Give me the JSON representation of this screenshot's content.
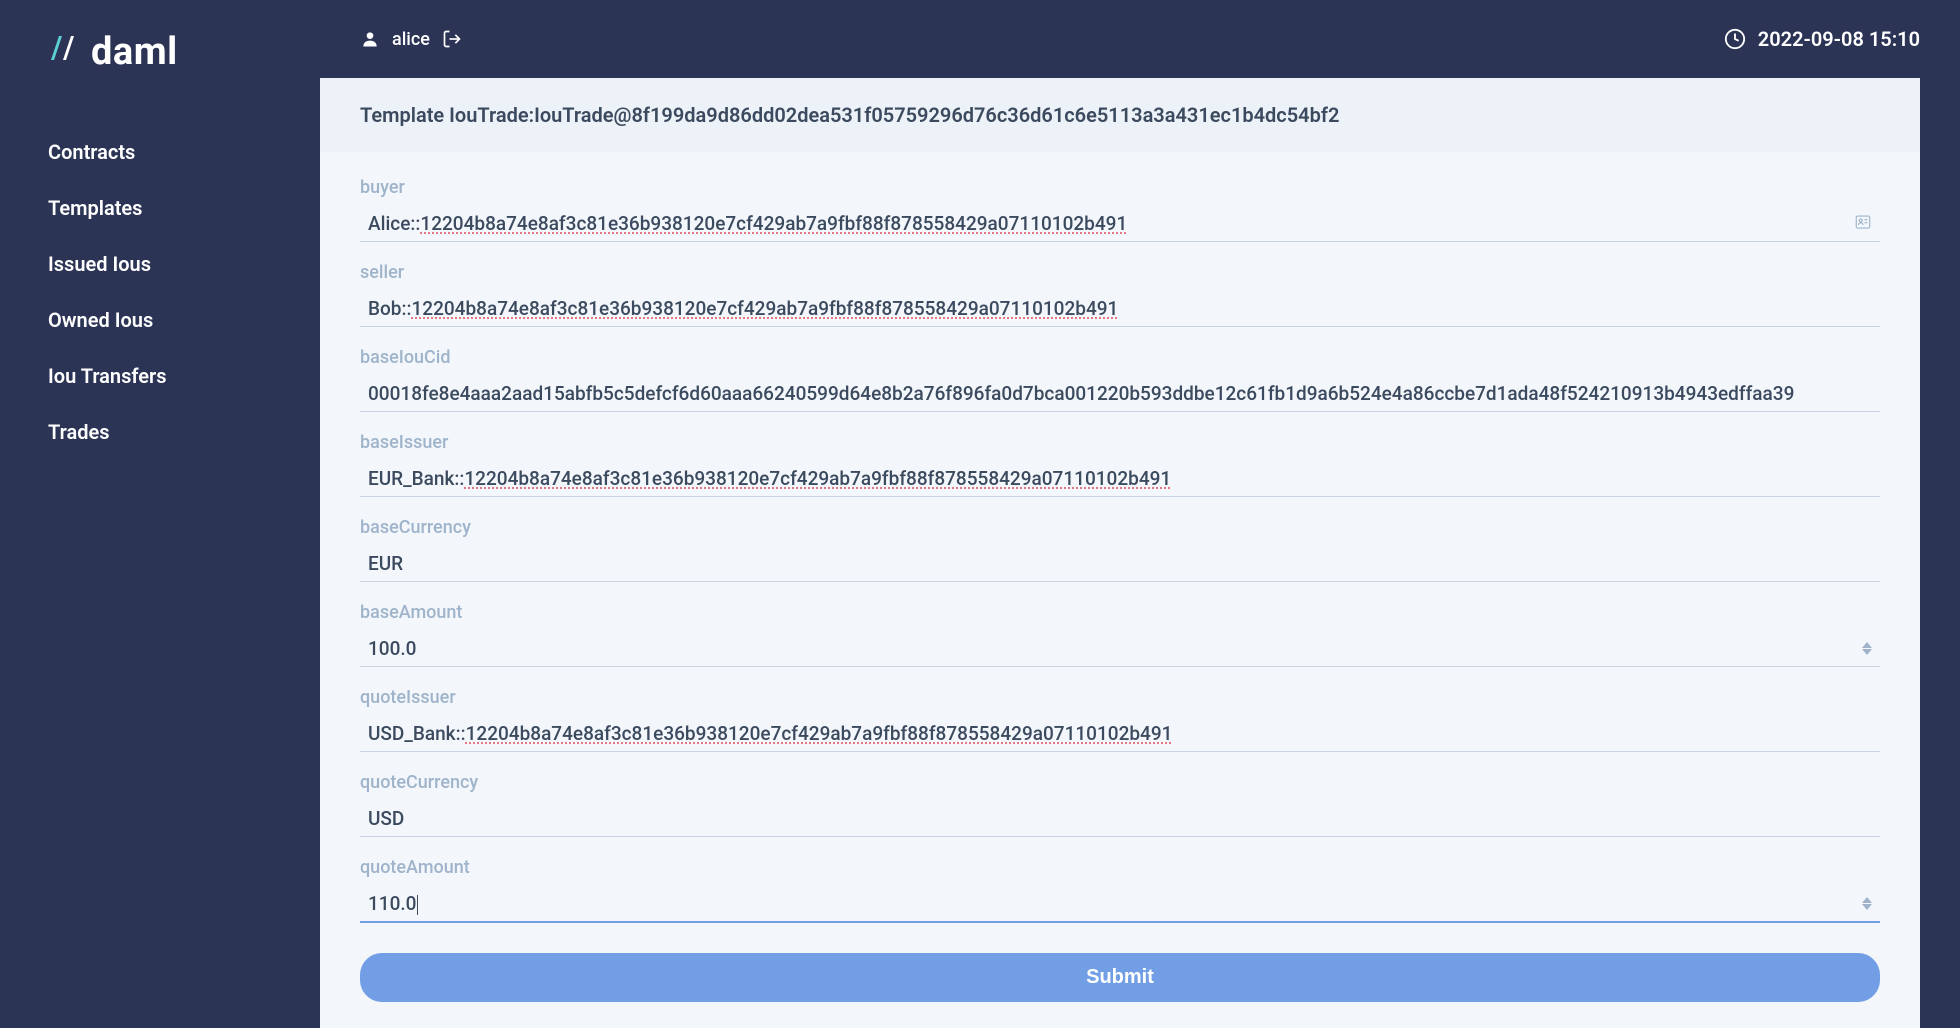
{
  "logo": {
    "text": "daml"
  },
  "sidebar": {
    "items": [
      {
        "label": "Contracts"
      },
      {
        "label": "Templates"
      },
      {
        "label": "Issued Ious"
      },
      {
        "label": "Owned Ious"
      },
      {
        "label": "Iou Transfers"
      },
      {
        "label": "Trades"
      }
    ]
  },
  "topbar": {
    "user": "alice",
    "datetime": "2022-09-08 15:10"
  },
  "template": {
    "header": "Template IouTrade:IouTrade@8f199da9d86dd02dea531f05759296d76c36d61c6e5113a3a431ec1b4dc54bf2"
  },
  "form": {
    "fields": {
      "buyer": {
        "label": "buyer",
        "prefix": "Alice::",
        "hash": "12204b8a74e8af3c81e36b938120e7cf429ab7a9fbf88f878558429a07110102b491"
      },
      "seller": {
        "label": "seller",
        "prefix": "Bob::",
        "hash": "12204b8a74e8af3c81e36b938120e7cf429ab7a9fbf88f878558429a07110102b491"
      },
      "baseIouCid": {
        "label": "baseIouCid",
        "value": "00018fe8e4aaa2aad15abfb5c5defcf6d60aaa66240599d64e8b2a76f896fa0d7bca001220b593ddbe12c61fb1d9a6b524e4a86ccbe7d1ada48f524210913b4943edffaa39"
      },
      "baseIssuer": {
        "label": "baseIssuer",
        "prefix": "EUR_Bank::",
        "hash": "12204b8a74e8af3c81e36b938120e7cf429ab7a9fbf88f878558429a07110102b491"
      },
      "baseCurrency": {
        "label": "baseCurrency",
        "value": "EUR"
      },
      "baseAmount": {
        "label": "baseAmount",
        "value": "100.0"
      },
      "quoteIssuer": {
        "label": "quoteIssuer",
        "prefix": "USD_Bank::",
        "hash": "12204b8a74e8af3c81e36b938120e7cf429ab7a9fbf88f878558429a07110102b491"
      },
      "quoteCurrency": {
        "label": "quoteCurrency",
        "value": "USD"
      },
      "quoteAmount": {
        "label": "quoteAmount",
        "value": "110.0"
      }
    },
    "submit_label": "Submit"
  }
}
